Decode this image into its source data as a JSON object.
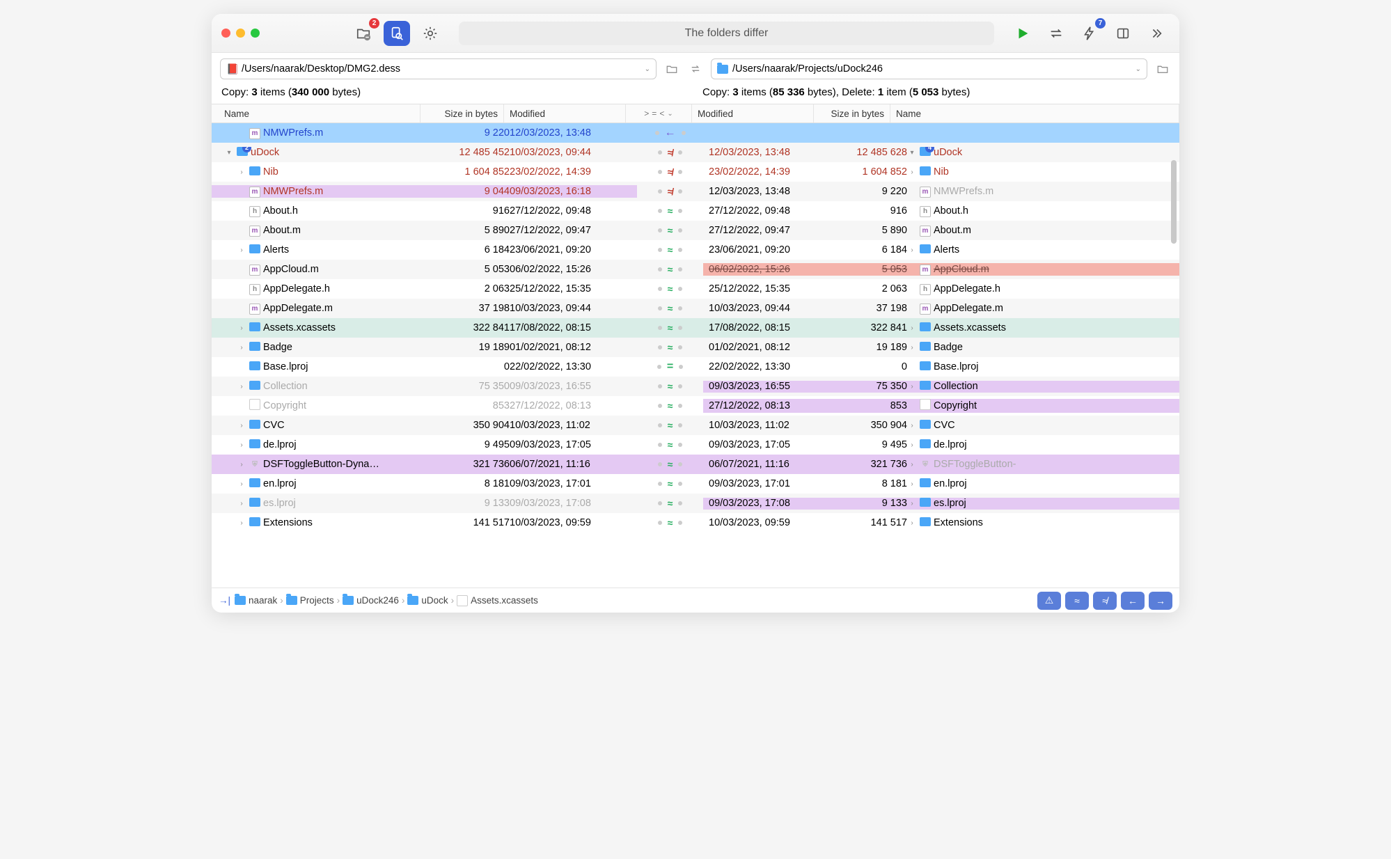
{
  "title_status": "The folders differ",
  "toolbar_badges": {
    "filter": "2",
    "bolt": "7"
  },
  "left_path": "/Users/naarak/Desktop/DMG2.dess",
  "right_path": "/Users/naarak/Projects/uDock246",
  "summary_left": {
    "prefix": "Copy: ",
    "items": "3",
    "items_suffix": " items (",
    "bytes": "340 000",
    "bytes_suffix": " bytes)"
  },
  "summary_right": {
    "prefix": "Copy: ",
    "items": "3",
    "items_suffix": " items (",
    "bytes": "85 336",
    "bytes_suffix": " bytes), Delete: ",
    "del_items": "1",
    "del_suffix": " item (",
    "del_bytes": "5 053",
    "del_end": " bytes)"
  },
  "headers": {
    "name": "Name",
    "size": "Size in bytes",
    "modified": "Modified",
    "cmp1": ">",
    "cmp2": "=",
    "cmp3": "<"
  },
  "rows": [
    {
      "l_name": "NMWPrefs.m",
      "l_icon": "m",
      "l_size": "9 220",
      "l_mod": "12/03/2023, 13:48",
      "cmp": "←",
      "r_mod": "",
      "r_size": "",
      "r_name": "",
      "style": "sel-blue",
      "indent": 1,
      "r_icon": ""
    },
    {
      "l_name": "uDock",
      "l_icon": "folder",
      "l_size": "12 485 452",
      "l_mod": "10/03/2023, 09:44",
      "cmp": "≉",
      "r_mod": "12/03/2023, 13:48",
      "r_size": "12 485 628",
      "r_name": "uDock",
      "r_icon": "folder",
      "style": "diff-red stripe",
      "indent": 0,
      "l_badge": "2",
      "r_badge": "4",
      "disc_l": "▾",
      "disc_r": "▾"
    },
    {
      "l_name": "Nib",
      "l_icon": "folder",
      "l_size": "1 604 852",
      "l_mod": "23/02/2022, 14:39",
      "cmp": "≉",
      "r_mod": "23/02/2022, 14:39",
      "r_size": "1 604 852",
      "r_name": "Nib",
      "r_icon": "folder",
      "style": "diff-red",
      "indent": 1,
      "disc_l": "›",
      "disc_r": "›"
    },
    {
      "l_name": "NMWPrefs.m",
      "l_icon": "m",
      "l_size": "9 044",
      "l_mod": "09/03/2023, 16:18",
      "cmp": "≉",
      "r_mod": "12/03/2023, 13:48",
      "r_size": "9 220",
      "r_name": "NMWPrefs.m",
      "r_icon": "m",
      "style": "diff-purple-l stripe ghost-r",
      "indent": 1
    },
    {
      "l_name": "About.h",
      "l_icon": "h",
      "l_size": "916",
      "l_mod": "27/12/2022, 09:48",
      "cmp": "≈",
      "r_mod": "27/12/2022, 09:48",
      "r_size": "916",
      "r_name": "About.h",
      "r_icon": "h",
      "style": "",
      "indent": 1
    },
    {
      "l_name": "About.m",
      "l_icon": "m",
      "l_size": "5 890",
      "l_mod": "27/12/2022, 09:47",
      "cmp": "≈",
      "r_mod": "27/12/2022, 09:47",
      "r_size": "5 890",
      "r_name": "About.m",
      "r_icon": "m",
      "style": "stripe",
      "indent": 1
    },
    {
      "l_name": "Alerts",
      "l_icon": "folder",
      "l_size": "6 184",
      "l_mod": "23/06/2021, 09:20",
      "cmp": "≈",
      "r_mod": "23/06/2021, 09:20",
      "r_size": "6 184",
      "r_name": "Alerts",
      "r_icon": "folder",
      "style": "",
      "indent": 1,
      "disc_l": "›",
      "disc_r": "›"
    },
    {
      "l_name": "AppCloud.m",
      "l_icon": "m",
      "l_size": "5 053",
      "l_mod": "06/02/2022, 15:26",
      "cmp": "≈",
      "r_mod": "06/02/2022, 15:26",
      "r_size": "5 053",
      "r_name": "AppCloud.m",
      "r_icon": "m",
      "style": "del-r stripe",
      "indent": 1,
      "strike_r": true
    },
    {
      "l_name": "AppDelegate.h",
      "l_icon": "h",
      "l_size": "2 063",
      "l_mod": "25/12/2022, 15:35",
      "cmp": "≈",
      "r_mod": "25/12/2022, 15:35",
      "r_size": "2 063",
      "r_name": "AppDelegate.h",
      "r_icon": "h",
      "style": "",
      "indent": 1
    },
    {
      "l_name": "AppDelegate.m",
      "l_icon": "m",
      "l_size": "37 198",
      "l_mod": "10/03/2023, 09:44",
      "cmp": "≈",
      "r_mod": "10/03/2023, 09:44",
      "r_size": "37 198",
      "r_name": "AppDelegate.m",
      "r_icon": "m",
      "style": "stripe",
      "indent": 1
    },
    {
      "l_name": "Assets.xcassets",
      "l_icon": "folder",
      "l_size": "322 841",
      "l_mod": "17/08/2022, 08:15",
      "cmp": "≈",
      "r_mod": "17/08/2022, 08:15",
      "r_size": "322 841",
      "r_name": "Assets.xcassets",
      "r_icon": "folder",
      "style": "teal",
      "indent": 1,
      "disc_l": "›",
      "disc_r": "›"
    },
    {
      "l_name": "Badge",
      "l_icon": "folder",
      "l_size": "19 189",
      "l_mod": "01/02/2021, 08:12",
      "cmp": "≈",
      "r_mod": "01/02/2021, 08:12",
      "r_size": "19 189",
      "r_name": "Badge",
      "r_icon": "folder",
      "style": "stripe",
      "indent": 1,
      "disc_l": "›",
      "disc_r": "›"
    },
    {
      "l_name": "Base.lproj",
      "l_icon": "folder",
      "l_size": "0",
      "l_mod": "22/02/2022, 13:30",
      "cmp": "=",
      "r_mod": "22/02/2022, 13:30",
      "r_size": "0",
      "r_name": "Base.lproj",
      "r_icon": "folder",
      "style": "",
      "indent": 1
    },
    {
      "l_name": "Collection",
      "l_icon": "folder",
      "l_size": "75 350",
      "l_mod": "09/03/2023, 16:55",
      "cmp": "≈",
      "r_mod": "09/03/2023, 16:55",
      "r_size": "75 350",
      "r_name": "Collection",
      "r_icon": "folder",
      "style": "purple-r stripe ghost-l",
      "indent": 1,
      "disc_l": "›",
      "disc_r": "›"
    },
    {
      "l_name": "Copyright",
      "l_icon": "doc",
      "l_size": "853",
      "l_mod": "27/12/2022, 08:13",
      "cmp": "≈",
      "r_mod": "27/12/2022, 08:13",
      "r_size": "853",
      "r_name": "Copyright",
      "r_icon": "doc",
      "style": "purple-r ghost-l",
      "indent": 1
    },
    {
      "l_name": "CVC",
      "l_icon": "folder",
      "l_size": "350 904",
      "l_mod": "10/03/2023, 11:02",
      "cmp": "≈",
      "r_mod": "10/03/2023, 11:02",
      "r_size": "350 904",
      "r_name": "CVC",
      "r_icon": "folder",
      "style": "stripe",
      "indent": 1,
      "disc_l": "›",
      "disc_r": "›"
    },
    {
      "l_name": "de.lproj",
      "l_icon": "folder",
      "l_size": "9 495",
      "l_mod": "09/03/2023, 17:05",
      "cmp": "≈",
      "r_mod": "09/03/2023, 17:05",
      "r_size": "9 495",
      "r_name": "de.lproj",
      "r_icon": "folder",
      "style": "",
      "indent": 1,
      "disc_l": "›",
      "disc_r": "›"
    },
    {
      "l_name": "DSFToggleButton-Dyna…",
      "l_icon": "shield",
      "l_size": "321 736",
      "l_mod": "06/07/2021, 11:16",
      "cmp": "≈",
      "r_mod": "06/07/2021, 11:16",
      "r_size": "321 736",
      "r_name": "DSFToggleButton-",
      "r_icon": "shield",
      "style": "purple-both stripe ghost-r",
      "indent": 1,
      "disc_l": "›",
      "disc_r": "›"
    },
    {
      "l_name": "en.lproj",
      "l_icon": "folder",
      "l_size": "8 181",
      "l_mod": "09/03/2023, 17:01",
      "cmp": "≈",
      "r_mod": "09/03/2023, 17:01",
      "r_size": "8 181",
      "r_name": "en.lproj",
      "r_icon": "folder",
      "style": "",
      "indent": 1,
      "disc_l": "›",
      "disc_r": "›"
    },
    {
      "l_name": "es.lproj",
      "l_icon": "folder",
      "l_size": "9 133",
      "l_mod": "09/03/2023, 17:08",
      "cmp": "≈",
      "r_mod": "09/03/2023, 17:08",
      "r_size": "9 133",
      "r_name": "es.lproj",
      "r_icon": "folder",
      "style": "purple-r stripe ghost-l",
      "indent": 1,
      "disc_l": "›",
      "disc_r": "›"
    },
    {
      "l_name": "Extensions",
      "l_icon": "folder",
      "l_size": "141 517",
      "l_mod": "10/03/2023, 09:59",
      "cmp": "≈",
      "r_mod": "10/03/2023, 09:59",
      "r_size": "141 517",
      "r_name": "Extensions",
      "r_icon": "folder",
      "style": "",
      "indent": 1,
      "disc_l": "›",
      "disc_r": "›"
    }
  ],
  "breadcrumbs": [
    "naarak",
    "Projects",
    "uDock246",
    "uDock",
    "Assets.xcassets"
  ],
  "footer_buttons": [
    "⚠",
    "≈",
    "≉",
    "←",
    "→"
  ]
}
